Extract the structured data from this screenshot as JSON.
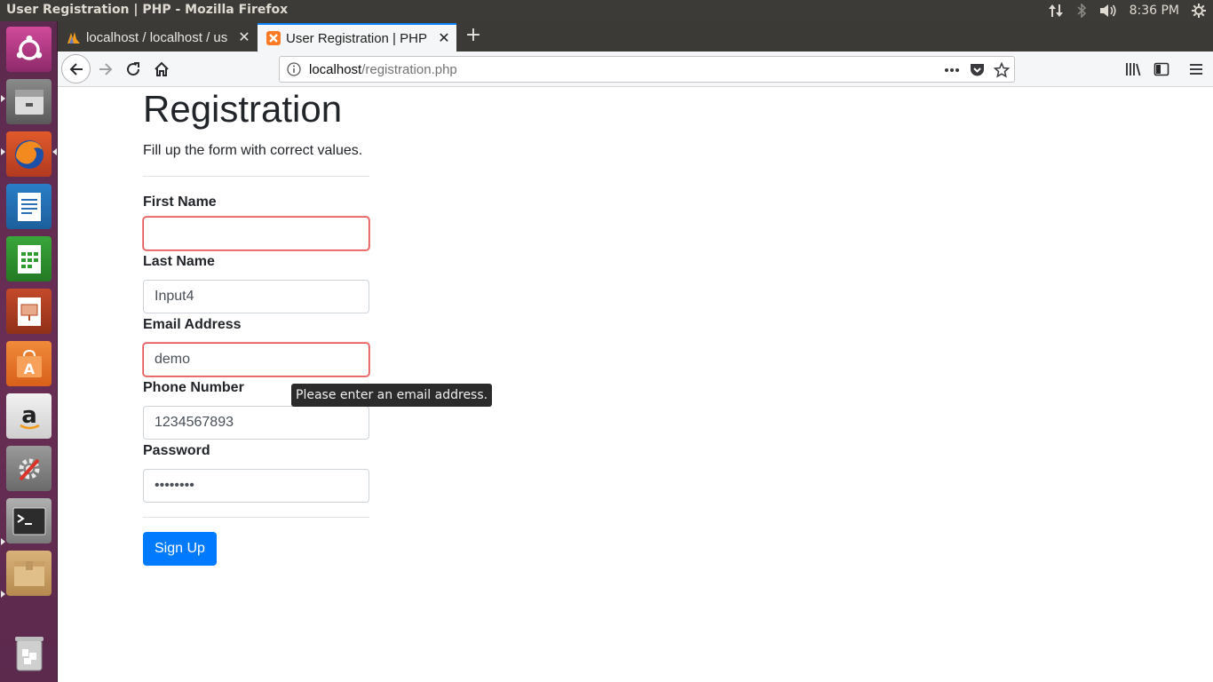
{
  "window": {
    "title": "User Registration | PHP - Mozilla Firefox",
    "clock": "8:36 PM"
  },
  "launcher": {
    "apps": [
      "ubuntu-dash-icon",
      "file-manager-icon",
      "firefox-icon",
      "libreoffice-writer-icon",
      "libreoffice-calc-icon",
      "libreoffice-impress-icon",
      "software-center-icon",
      "amazon-icon",
      "system-settings-icon",
      "terminal-icon",
      "archive-icon",
      "trash-icon"
    ]
  },
  "tabs": [
    {
      "label": "localhost / localhost / us",
      "active": false
    },
    {
      "label": "User Registration | PHP",
      "active": true
    }
  ],
  "address_bar": {
    "host": "localhost",
    "path": "/registration.php"
  },
  "form": {
    "title": "Registration",
    "subtitle": "Fill up the form with correct values.",
    "first_name_label": "First Name",
    "first_name_value": "",
    "last_name_label": "Last Name",
    "last_name_value": "Input4",
    "email_label": "Email Address",
    "email_value": "demo",
    "phone_label": "Phone Number",
    "phone_value": "1234567893",
    "password_label": "Password",
    "password_value": "••••••••",
    "submit_label": "Sign Up"
  },
  "validation_tooltip": "Please enter an email address.",
  "colors": {
    "primary": "#007bff",
    "invalid_border": "#e35050",
    "launcher": "#5c2a4e",
    "active_tab_accent": "#0a84ff"
  }
}
